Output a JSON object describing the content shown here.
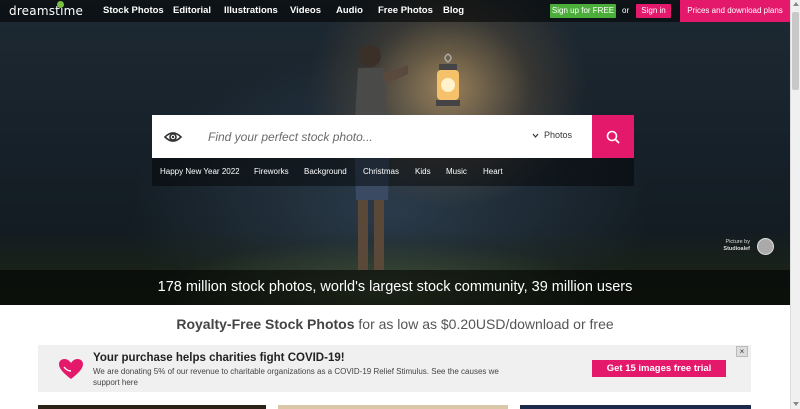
{
  "header": {
    "logo": "dreamstime",
    "nav": [
      "Stock Photos",
      "Editorial",
      "Illustrations",
      "Videos",
      "Audio",
      "Free Photos",
      "Blog"
    ],
    "signup_label": "Sign up for FREE",
    "or_label": "or",
    "signin_label": "Sign in",
    "prices_label": "Prices and download plans"
  },
  "search": {
    "placeholder": "Find your perfect stock photo...",
    "category": "Photos"
  },
  "tags": [
    "Happy New Year 2022",
    "Fireworks",
    "Background",
    "Christmas",
    "Kids",
    "Music",
    "Heart"
  ],
  "credit": {
    "label": "Picture by",
    "author": "Studioalef"
  },
  "hero_stats": "178 million stock photos, world's largest stock community, 39 million users",
  "royalty": {
    "bold": "Royalty-Free Stock Photos",
    "rest": " for as low as $0.20USD/download or free"
  },
  "charity": {
    "title": "Your purchase helps charities fight COVID-19!",
    "text": "We are donating 5% of our revenue to charitable organizations as a COVID-19 Relief Stimulus. See the causes we support here",
    "button": "Get 15 images free trial",
    "close": "×"
  },
  "colors": {
    "brand_pink": "#e5196c",
    "signup_green": "#4cae3a"
  }
}
